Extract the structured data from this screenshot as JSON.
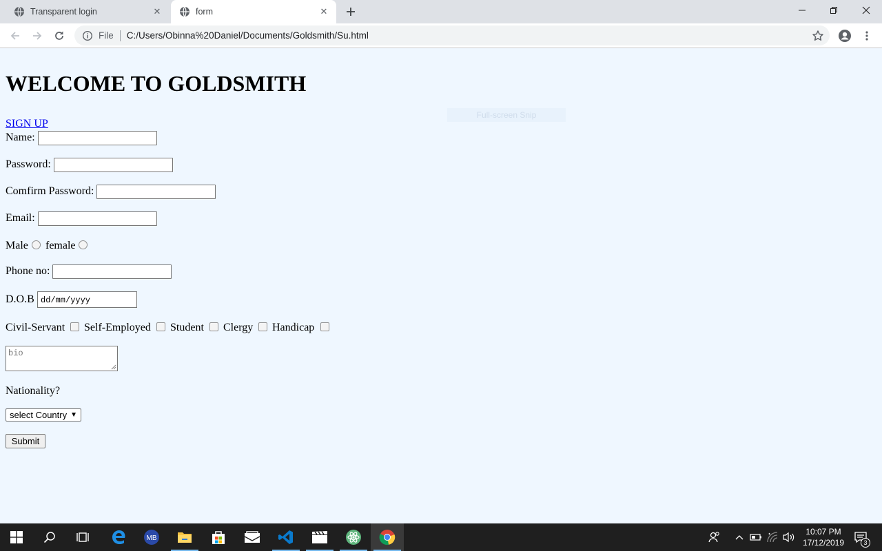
{
  "browser": {
    "tabs": [
      {
        "title": "Transparent login",
        "active": false
      },
      {
        "title": "form",
        "active": true
      }
    ],
    "address": {
      "scheme_label": "File",
      "url": "C:/Users/Obinna%20Daniel/Documents/Goldsmith/Su.html"
    }
  },
  "page": {
    "heading": "WELCOME TO GOLDSMITH",
    "signup_link": "SIGN UP",
    "overlay_hint": "Full-screen Snip",
    "form": {
      "name_label": "Name:",
      "password_label": "Password:",
      "confirm_password_label": "Comfirm Password:",
      "email_label": "Email:",
      "gender": {
        "male_label": "Male",
        "female_label": "female"
      },
      "phone_label": "Phone no:",
      "dob_label": "D.O.B",
      "dob_placeholder": "dd/mm/yyyy",
      "occupations": [
        "Civil-Servant",
        "Self-Employed",
        "Student",
        "Clergy",
        "Handicap"
      ],
      "bio_placeholder": "bio",
      "nationality_label": "Nationality?",
      "country_select_value": "select Country",
      "submit_label": "Submit"
    }
  },
  "taskbar": {
    "pinned": [
      "windows-start",
      "search",
      "task-view",
      "edge",
      "malwarebytes",
      "file-explorer",
      "microsoft-store",
      "mail",
      "vs-code",
      "movies-tv",
      "atom",
      "chrome"
    ],
    "clock": {
      "time": "10:07 PM",
      "date": "17/12/2019"
    },
    "notification_count": "3"
  },
  "colors": {
    "page_background": "#eff7ff",
    "link": "#0000ee",
    "taskbar": "#1f1f1f",
    "tabstrip": "#dee1e6",
    "running_indicator": "#76b9ed"
  }
}
